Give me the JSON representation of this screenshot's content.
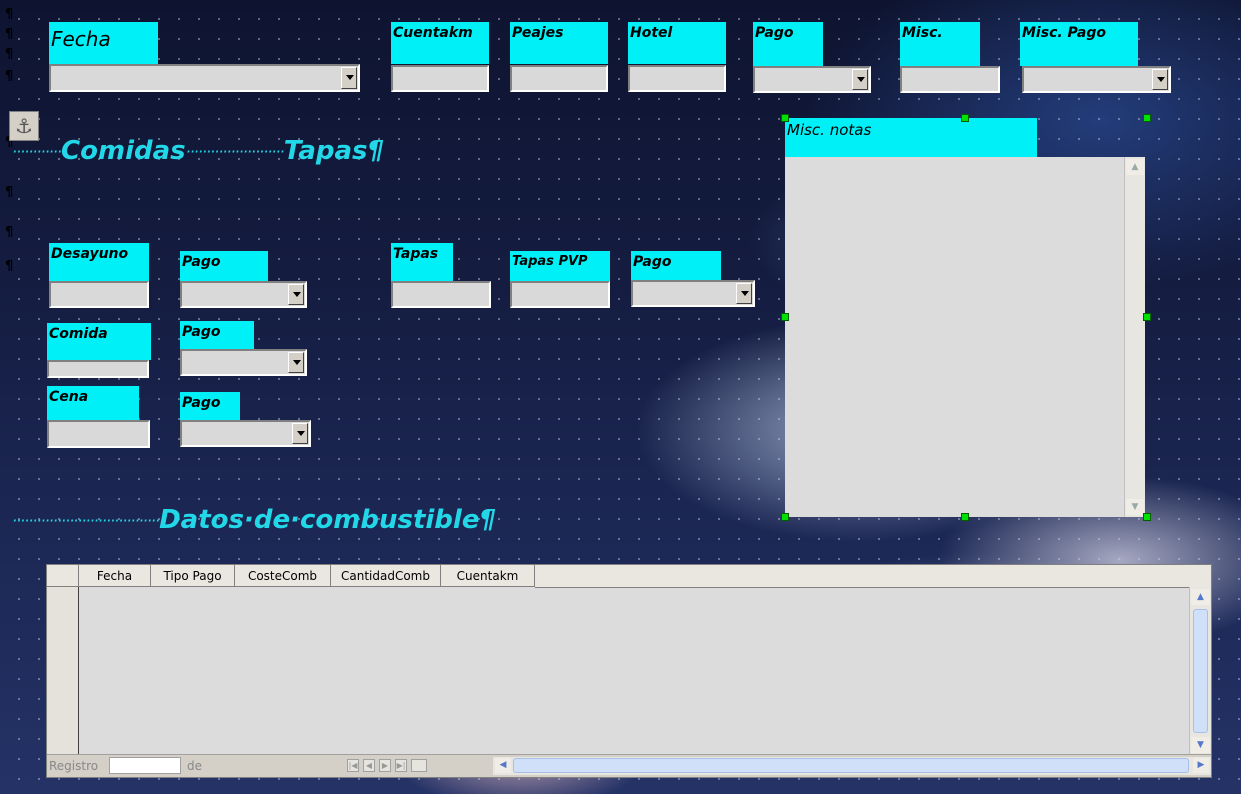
{
  "top_fields": {
    "fecha": "Fecha",
    "cuentakm": "Cuentakm",
    "peajes": "Peajes",
    "hotel": "Hotel",
    "pago": "Pago",
    "misc": "Misc.",
    "misc_pago": "Misc. Pago"
  },
  "headings": {
    "comidas": "Comidas",
    "tapas": "Tapas",
    "combustible": "Datos·de·combustible",
    "dots": "············",
    "pilcrow": "¶"
  },
  "comidas": {
    "desayuno": "Desayuno",
    "comida": "Comida",
    "cena": "Cena",
    "pago": "Pago"
  },
  "tapas": {
    "tapas": "Tapas",
    "tapas_pvp": "Tapas PVP",
    "pago": "Pago"
  },
  "notes": {
    "label": "Misc. notas"
  },
  "grid": {
    "columns": [
      "Fecha",
      "Tipo Pago",
      "CosteComb",
      "CantidadComb",
      "Cuentakm"
    ],
    "nav_registro": "Registro",
    "nav_de": "de"
  },
  "icons": {
    "anchor": "anchor-icon",
    "combo_arrow": "chevron-down-icon"
  }
}
